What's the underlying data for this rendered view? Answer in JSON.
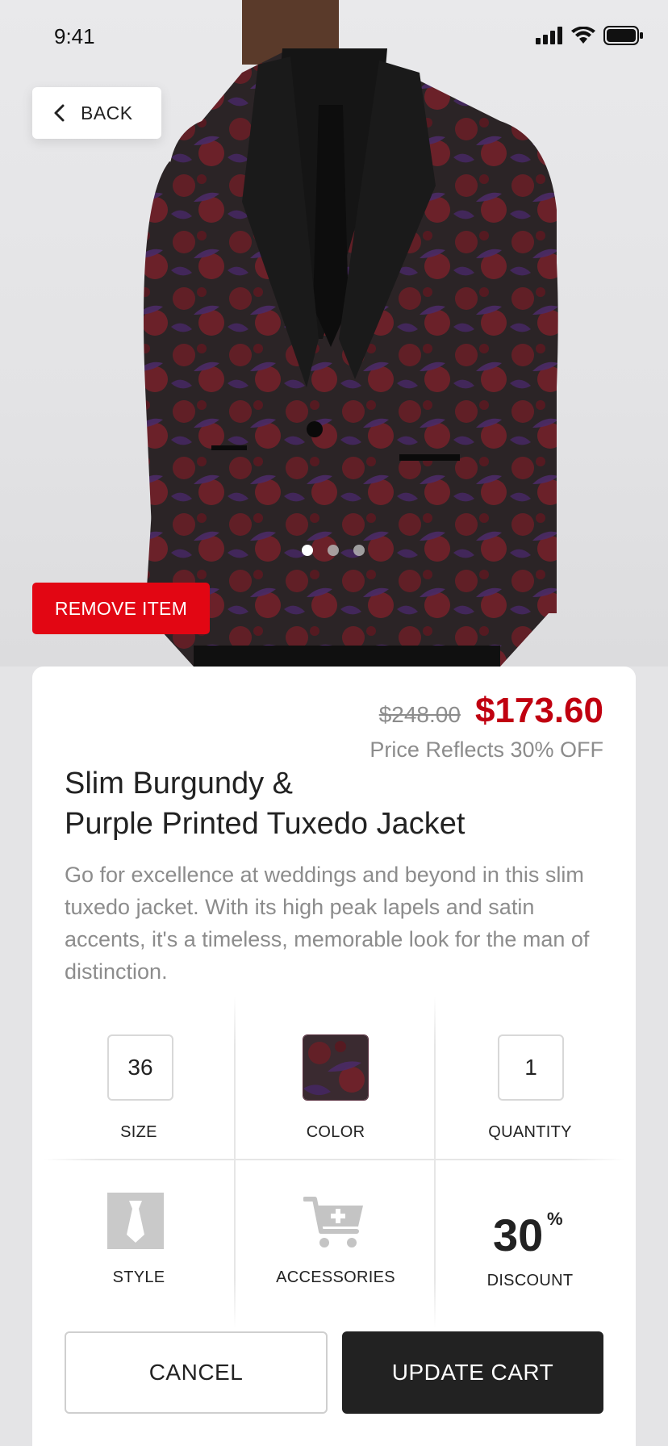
{
  "status_bar": {
    "time": "9:41"
  },
  "nav": {
    "back_label": "BACK"
  },
  "gallery": {
    "slides": 3,
    "active_slide": 1
  },
  "remove_label": "REMOVE ITEM",
  "product": {
    "old_price": "$248.00",
    "new_price": "$173.60",
    "price_note": "Price Reflects 30% OFF",
    "title_line1": "Slim Burgundy &",
    "title_line2": "Purple Printed Tuxedo Jacket",
    "description": "Go for excellence at weddings and beyond in this slim tuxedo jacket. With its high peak lapels and satin accents, it's a timeless, memorable look for the man of distinction."
  },
  "options": {
    "size": {
      "value": "36",
      "label": "SIZE"
    },
    "color": {
      "label": "COLOR",
      "swatch": "#4a2a33"
    },
    "quantity": {
      "value": "1",
      "label": "QUANTITY"
    },
    "style": {
      "label": "STYLE",
      "icon": "tie-icon"
    },
    "accessories": {
      "label": "ACCESSORIES",
      "icon": "cart-add-icon"
    },
    "discount": {
      "value": "30",
      "unit": "%",
      "label": "DISCOUNT"
    }
  },
  "actions": {
    "cancel_label": "CANCEL",
    "update_label": "UPDATE CART"
  },
  "colors": {
    "accent_red": "#e20613",
    "price_red": "#c00010",
    "dark": "#222222",
    "muted": "#8c8c8c"
  }
}
